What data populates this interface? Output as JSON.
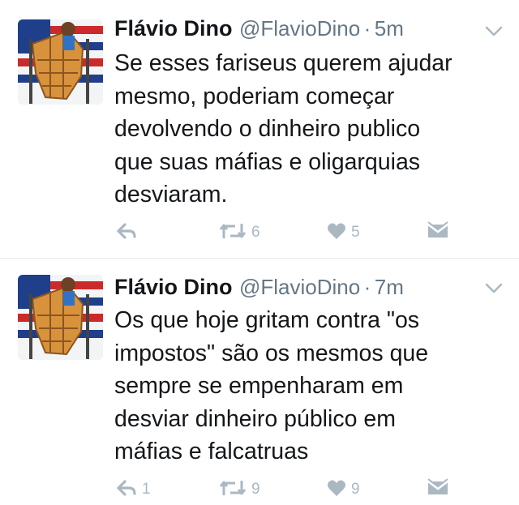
{
  "tweets": [
    {
      "name": "Flávio Dino",
      "handle": "@FlavioDino",
      "separator": "·",
      "time": "5m",
      "text": "Se esses fariseus querem ajudar\nmesmo, poderiam começar\ndevolvendo o dinheiro publico\nque suas máfias e oligarquias\ndesviaram.",
      "reply_count": "",
      "retweet_count": "6",
      "like_count": "5"
    },
    {
      "name": "Flávio Dino",
      "handle": "@FlavioDino",
      "separator": "·",
      "time": "7m",
      "text": "Os que hoje gritam contra \"os\nimpostos\" são os mesmos que\nsempre se empenharam em\ndesviar dinheiro público em\nmáfias e falcatruas",
      "reply_count": "1",
      "retweet_count": "9",
      "like_count": "9"
    }
  ],
  "colors": {
    "icon_gray": "#aab8c2",
    "text_primary": "#14171a",
    "text_secondary": "#657786",
    "divider": "#e1e8ed"
  },
  "icons": [
    "reply-icon",
    "retweet-icon",
    "like-icon",
    "direct-message-icon",
    "chevron-down-icon"
  ]
}
